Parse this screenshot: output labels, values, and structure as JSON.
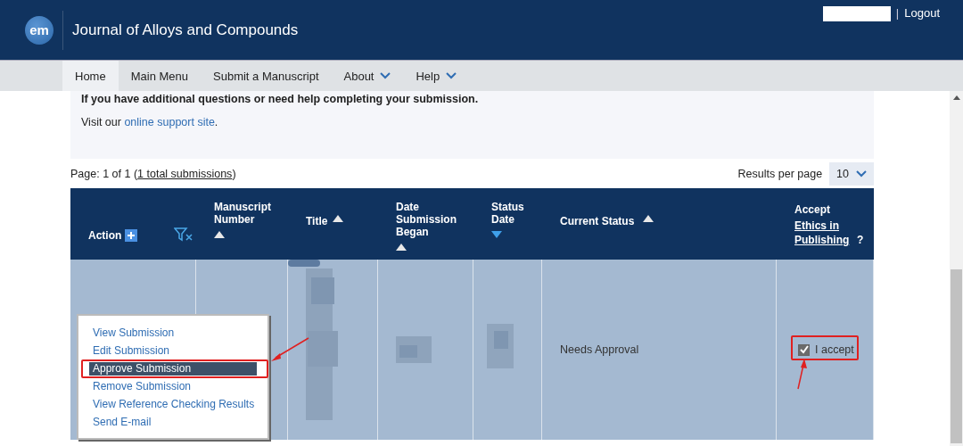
{
  "header": {
    "logo": "em",
    "title": "Journal of Alloys and Compounds",
    "separator": "|",
    "logout": "Logout"
  },
  "nav": [
    {
      "label": "Home",
      "selected": true,
      "dropdown": false
    },
    {
      "label": "Main Menu",
      "selected": false,
      "dropdown": false
    },
    {
      "label": "Submit a Manuscript",
      "selected": false,
      "dropdown": false
    },
    {
      "label": "About",
      "selected": false,
      "dropdown": true
    },
    {
      "label": "Help",
      "selected": false,
      "dropdown": true
    }
  ],
  "notice": {
    "text": "If you have additional questions or need help completing your submission.",
    "visit": "Visit our ",
    "link": "online support site",
    "end": "."
  },
  "pager": {
    "prefix": "Page: 1 of 1 (",
    "link": "1 total submissions",
    "suffix": ")",
    "results_label": "Results per page",
    "results_value": "10"
  },
  "table": {
    "columns": [
      {
        "kind": "action",
        "label": "Action"
      },
      {
        "kind": "filter"
      },
      {
        "kind": "sort",
        "label": "Manuscript Number",
        "descending": false
      },
      {
        "kind": "sort",
        "label": "Title",
        "descending": false
      },
      {
        "kind": "sort",
        "label": "Date Submission Began",
        "descending": false
      },
      {
        "kind": "sort",
        "label": "Status Date",
        "descending": true
      },
      {
        "kind": "sort",
        "label": "Current Status",
        "descending": false
      },
      {
        "kind": "ethics",
        "label": "Accept",
        "link": "Ethics in Publishing",
        "suffix": "?"
      }
    ],
    "row": {
      "current_status": "Needs Approval",
      "accept_label": "I accept",
      "accept_checked": true
    }
  },
  "action_menu": [
    {
      "label": "View Submission",
      "selected": false
    },
    {
      "label": "Edit Submission",
      "selected": false
    },
    {
      "label": "Approve Submission",
      "selected": true
    },
    {
      "label": "Remove Submission",
      "selected": false
    },
    {
      "label": "View Reference Checking Results",
      "selected": false
    },
    {
      "label": "Send E-mail",
      "selected": false
    }
  ]
}
